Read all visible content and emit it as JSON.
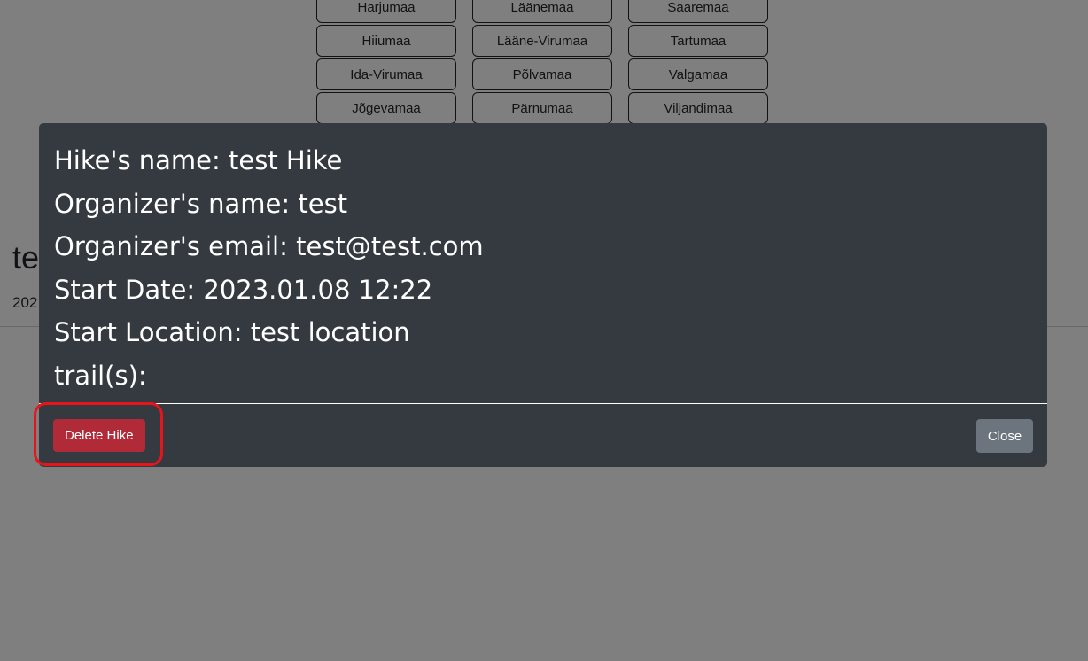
{
  "background": {
    "counties": [
      [
        "Harjumaa",
        "Läänemaa",
        "Saaremaa"
      ],
      [
        "Hiiumaa",
        "Lääne-Virumaa",
        "Tartumaa"
      ],
      [
        "Ida-Virumaa",
        "Põlvamaa",
        "Valgamaa"
      ],
      [
        "Jõgevamaa",
        "Pärnumaa",
        "Viljandimaa"
      ]
    ],
    "title_partial": "te",
    "date_partial": "202"
  },
  "modal": {
    "hike_name": "Hike's name: test Hike",
    "organizer_name": "Organizer's name: test",
    "organizer_email": "Organizer's email: test@test.com",
    "start_date": "Start Date: 2023.01.08 12:22",
    "start_location": "Start Location: test location",
    "trails": "trail(s):",
    "delete_label": "Delete Hike",
    "close_label": "Close"
  },
  "colors": {
    "modal_bg": "#343a40",
    "delete_button": "#b02a37",
    "close_button": "#6c757d",
    "highlight": "#e8141c"
  }
}
